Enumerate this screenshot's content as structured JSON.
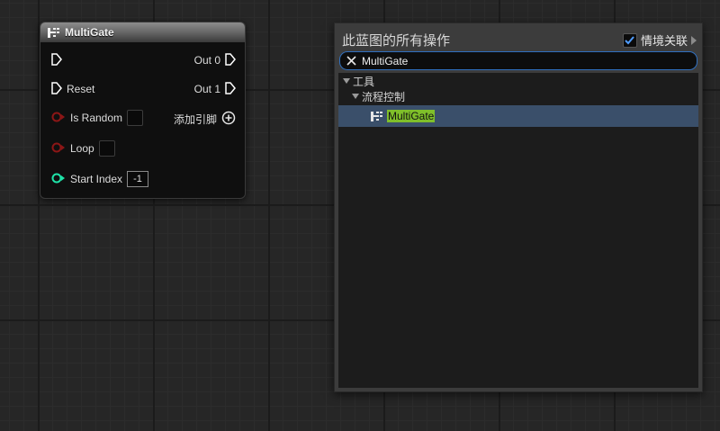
{
  "node": {
    "title": "MultiGate",
    "pins_left": [
      {
        "label": ""
      },
      {
        "label": "Reset"
      },
      {
        "label": "Is Random"
      },
      {
        "label": "Loop"
      },
      {
        "label": "Start Index",
        "value": "-1"
      }
    ],
    "pins_right": [
      {
        "label": "Out 0"
      },
      {
        "label": "Out 1"
      }
    ],
    "add_pin_label": "添加引脚"
  },
  "action_menu": {
    "title": "此蓝图的所有操作",
    "context_sensitive_label": "情境关联",
    "context_sensitive_checked": true,
    "search_value": "MultiGate",
    "tree": [
      {
        "label": "工具",
        "level": 0,
        "expanded": true
      },
      {
        "label": "流程控制",
        "level": 1,
        "expanded": true
      },
      {
        "label": "MultiGate",
        "level": 2,
        "selected": true
      }
    ]
  },
  "colors": {
    "background": "#262626",
    "exec_pin": "#ffffff",
    "bool_pin": "#8c1616",
    "int_pin": "#1fe3a8",
    "search_border": "#2f6fbf",
    "selection": "#3a4f6a",
    "highlight": "#7fbf2a"
  }
}
